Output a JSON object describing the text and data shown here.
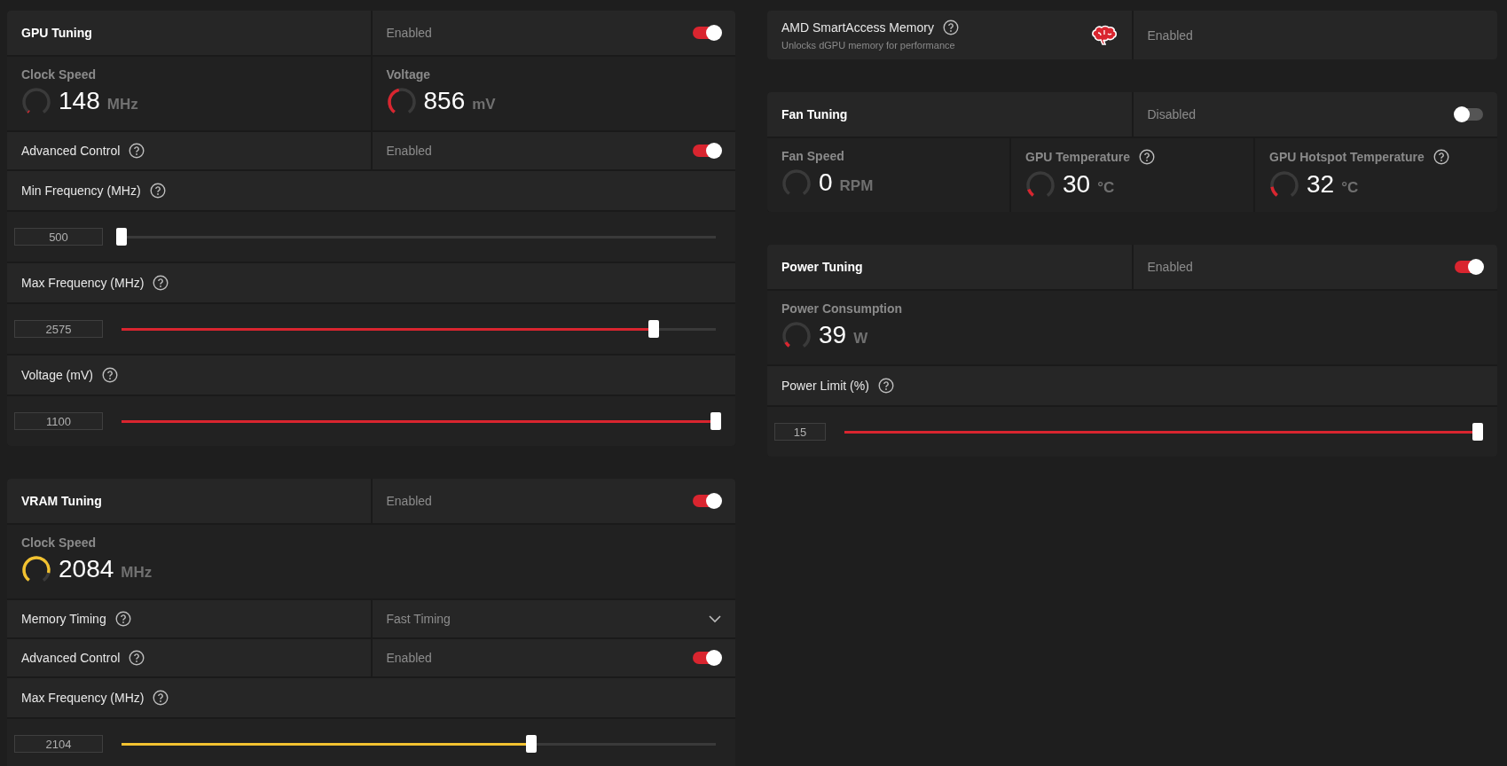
{
  "columns": [
    {
      "sections": [
        {
          "color": "#d9252f",
          "rows": [
            {
              "kind": "header",
              "title": "GPU Tuning",
              "status": "Enabled",
              "on": true
            },
            {
              "kind": "metrics",
              "items": [
                {
                  "label": "Clock Speed",
                  "value": "148",
                  "unit": "MHz",
                  "level": 0.02,
                  "help": false
                },
                {
                  "label": "Voltage",
                  "value": "856",
                  "unit": "mV",
                  "level": 0.45,
                  "help": false
                }
              ]
            },
            {
              "kind": "toggle",
              "label": "Advanced Control",
              "help": true,
              "status": "Enabled",
              "on": true
            },
            {
              "kind": "label",
              "text": "Min Frequency (MHz)",
              "help": true
            },
            {
              "kind": "slider",
              "value": "500",
              "level": 0
            },
            {
              "kind": "label",
              "text": "Max Frequency (MHz)",
              "help": true
            },
            {
              "kind": "slider",
              "value": "2575",
              "level": 0.895
            },
            {
              "kind": "label",
              "text": "Voltage (mV)",
              "help": true
            },
            {
              "kind": "slider",
              "value": "1100",
              "level": 1
            }
          ]
        },
        {
          "color": "#f2c230",
          "rows": [
            {
              "kind": "header",
              "title": "VRAM Tuning",
              "status": "Enabled",
              "on": true
            },
            {
              "kind": "metrics",
              "items": [
                {
                  "label": "Clock Speed",
                  "value": "2084",
                  "unit": "MHz",
                  "level": 0.85,
                  "help": false
                }
              ]
            },
            {
              "kind": "dropdown",
              "label": "Memory Timing",
              "help": true,
              "value": "Fast Timing"
            },
            {
              "kind": "toggle",
              "label": "Advanced Control",
              "help": true,
              "status": "Enabled",
              "on": true
            },
            {
              "kind": "label",
              "text": "Max Frequency (MHz)",
              "help": true
            },
            {
              "kind": "slider",
              "value": "2104",
              "level": 0.69
            }
          ]
        }
      ]
    },
    {
      "sections": [
        {
          "color": "#d9252f",
          "rows": [
            {
              "kind": "feature",
              "title": "AMD SmartAccess Memory",
              "subtitle": "Unlocks dGPU memory for performance",
              "help": true,
              "status": "Enabled"
            }
          ]
        },
        {
          "color": "#d9252f",
          "rows": [
            {
              "kind": "header",
              "title": "Fan Tuning",
              "status": "Disabled",
              "on": false
            },
            {
              "kind": "metrics",
              "items": [
                {
                  "label": "Fan Speed",
                  "value": "0",
                  "unit": "RPM",
                  "level": 0,
                  "help": false
                },
                {
                  "label": "GPU Temperature",
                  "value": "30",
                  "unit": "°C",
                  "level": 0.12,
                  "help": true
                },
                {
                  "label": "GPU Hotspot Temperature",
                  "value": "32",
                  "unit": "°C",
                  "level": 0.16,
                  "help": true
                }
              ]
            }
          ]
        },
        {
          "color": "#d9252f",
          "rows": [
            {
              "kind": "header",
              "title": "Power Tuning",
              "status": "Enabled",
              "on": true
            },
            {
              "kind": "metrics",
              "items": [
                {
                  "label": "Power Consumption",
                  "value": "39",
                  "unit": "W",
                  "level": 0.08,
                  "help": false
                }
              ]
            },
            {
              "kind": "label",
              "text": "Power Limit (%)",
              "help": true
            },
            {
              "kind": "slider",
              "value": "15",
              "level": 1
            }
          ]
        }
      ]
    }
  ]
}
